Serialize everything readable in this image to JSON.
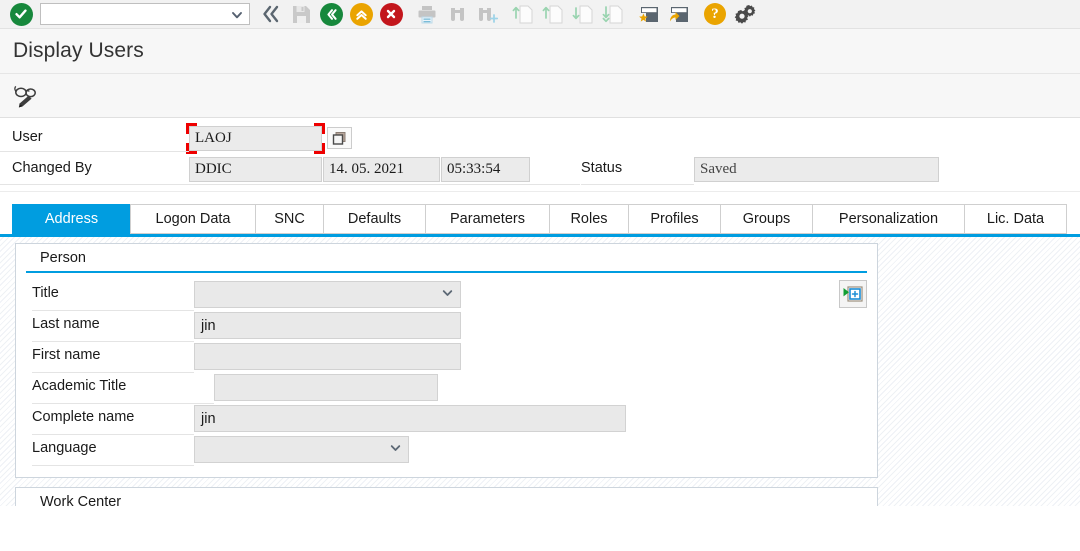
{
  "toolbar": {
    "command_field": {
      "value": "",
      "placeholder": ""
    },
    "icons": [
      {
        "name": "enter-ok-icon",
        "label": "Enter / Continue"
      },
      {
        "name": "back-double-chevron-icon",
        "label": "Back"
      },
      {
        "name": "save-disk-icon",
        "label": "Save"
      },
      {
        "name": "back-green-icon",
        "label": "Back"
      },
      {
        "name": "exit-up-yellow-icon",
        "label": "Exit"
      },
      {
        "name": "cancel-red-x-icon",
        "label": "Cancel"
      },
      {
        "name": "print-icon",
        "label": "Print"
      },
      {
        "name": "find-binoculars-icon",
        "label": "Find"
      },
      {
        "name": "find-next-binoculars-icon",
        "label": "Find Next"
      },
      {
        "name": "first-page-icon",
        "label": "First Page"
      },
      {
        "name": "previous-page-icon",
        "label": "Previous Page"
      },
      {
        "name": "next-page-icon",
        "label": "Next Page"
      },
      {
        "name": "last-page-icon",
        "label": "Last Page"
      },
      {
        "name": "create-favorite-icon",
        "label": "Create Session"
      },
      {
        "name": "create-shortcut-icon",
        "label": "Create Shortcut"
      },
      {
        "name": "help-icon",
        "label": "Help"
      },
      {
        "name": "customize-gear-icon",
        "label": "Customize Local Layout"
      }
    ]
  },
  "header": {
    "title": "Display Users"
  },
  "apptoolbar": {
    "display_change_label": "Display <-> Change",
    "icon": "glasses-pencil-icon"
  },
  "headerform": {
    "user_label": "User",
    "user_value": "LAOJ",
    "changed_by_label": "Changed By",
    "changed_by_value": "DDIC",
    "changed_date": "14. 05. 2021",
    "changed_time": "05:33:54",
    "status_label": "Status",
    "status_value": "Saved",
    "multiple_selection_label": "Multiple Selection"
  },
  "tabs": [
    {
      "label": "Address",
      "active": true
    },
    {
      "label": "Logon Data",
      "active": false
    },
    {
      "label": "SNC",
      "active": false
    },
    {
      "label": "Defaults",
      "active": false
    },
    {
      "label": "Parameters",
      "active": false
    },
    {
      "label": "Roles",
      "active": false
    },
    {
      "label": "Profiles",
      "active": false
    },
    {
      "label": "Groups",
      "active": false
    },
    {
      "label": "Personalization",
      "active": false
    },
    {
      "label": "Lic. Data",
      "active": false
    }
  ],
  "person_panel": {
    "title": "Person",
    "fields": {
      "title_label": "Title",
      "title_value": "",
      "last_name_label": "Last name",
      "last_name_value": "jin",
      "first_name_label": "First name",
      "first_name_value": "",
      "academic_title_label": "Academic Title",
      "academic_title_value": "",
      "complete_name_label": "Complete name",
      "complete_name_value": "jin",
      "language_label": "Language",
      "language_value": ""
    },
    "insert_button": {
      "name": "insert-personal-data-button",
      "label": "Insert"
    }
  },
  "workcenter_panel": {
    "title": "Work Center"
  },
  "colors": {
    "accent": "#009de0",
    "toolbar_bg": "#f2f2f2",
    "field_bg": "#e9e9e9",
    "annotation_red": "#ee0000",
    "green": "#17883c",
    "yellow": "#eaa400",
    "red": "#c3161c"
  }
}
